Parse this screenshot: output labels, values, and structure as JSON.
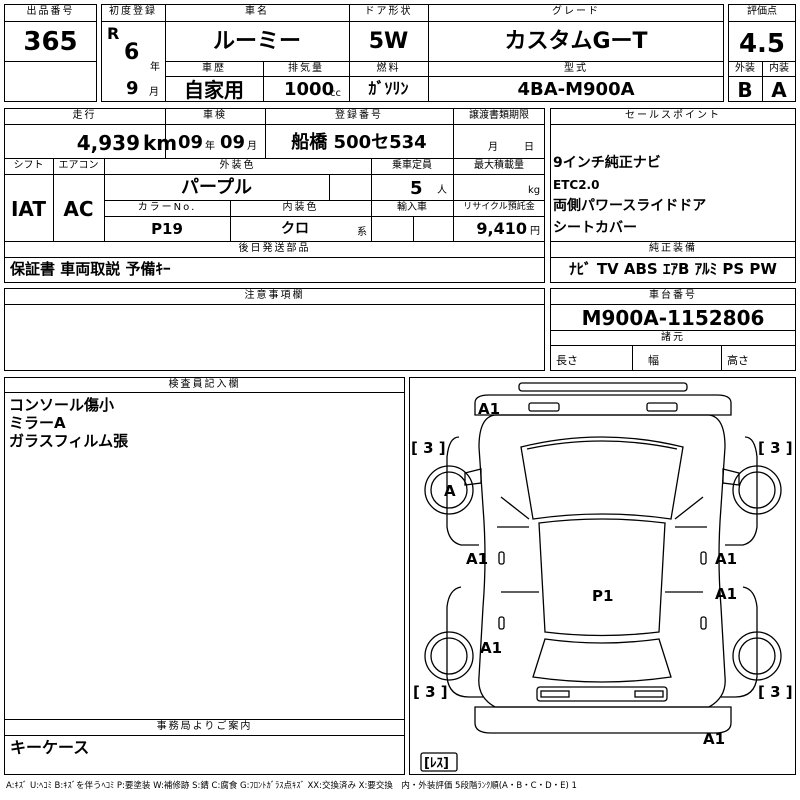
{
  "headers": {
    "lot": "出品番号",
    "first_reg": "初度登録",
    "car_name": "車名",
    "door": "ドア形状",
    "grade": "グレード",
    "score": "評価点",
    "history": "車歴",
    "displacement": "排気量",
    "fuel": "燃料",
    "model": "型式",
    "exterior": "外装",
    "interior": "内装",
    "mileage": "走行",
    "inspection": "車検",
    "plate": "登録番号",
    "transfer_docs": "譲渡書類期限",
    "sales_points": "セールスポイント",
    "shift": "シフト",
    "aircon": "エアコン",
    "ext_color": "外装色",
    "capacity": "乗車定員",
    "max_load": "最大積載量",
    "color_no": "カラーNo.",
    "int_color": "内装色",
    "import": "輸入車",
    "recycle": "リサイクル預託金",
    "later_parts": "後日発送部品",
    "genuine_equipment": "純正装備",
    "notes": "注意事項欄",
    "chassis": "車台番号",
    "specs": "諸元",
    "inspector": "検査員記入欄",
    "office": "事務局よりご案内"
  },
  "units": {
    "year": "年",
    "month": "月",
    "cc": "cc",
    "km": "km",
    "persons": "人",
    "kg": "kg",
    "kei": "系",
    "yen": "円",
    "length": "長さ",
    "width": "幅",
    "height": "高さ"
  },
  "vehicle": {
    "lot_number": "365",
    "era": "R",
    "reg_year": "6",
    "reg_month": "9",
    "car_name": "ルーミー",
    "door_type": "5W",
    "grade": "カスタムGーT",
    "score": "4.5",
    "history": "自家用",
    "displacement": "1000",
    "fuel": "ｶﾞｿﾘﾝ",
    "model_code": "4BA-M900A",
    "exterior_grade": "B",
    "interior_grade": "A",
    "mileage": "4,939",
    "inspection_year": "09",
    "inspection_month": "09",
    "plate": "船橋 500セ534",
    "shift": "IAT",
    "aircon": "AC",
    "ext_color": "パープル",
    "capacity": "5",
    "color_no": "P19",
    "int_color": "クロ",
    "recycle_fee": "9,410",
    "chassis_no": "M900A-1152806"
  },
  "sales_points": [
    "9インチ純正ナビ",
    "ETC2.0",
    "両側パワースライドドア",
    "シートカバー"
  ],
  "later_parts": "保証書 車両取説 予備ｷｰ",
  "genuine_equipment": "ﾅﾋﾞ TV ABS ｴｱB ｱﾙﾐ PS PW",
  "inspector_notes": [
    "コンソール傷小",
    "ミラーA",
    "ガラスフィルム張"
  ],
  "office_note": "キーケース",
  "diagram_marks": {
    "hood": "A1",
    "front_left_tire": "A",
    "left_front_door": "A1",
    "right_front_door": "A1",
    "right_rear_door": "A1",
    "roof": "P1",
    "left_rear_fender": "A1",
    "rear_bumper": "A1",
    "tire_fl": "[ 3 ]",
    "tire_fr": "[ 3 ]",
    "tire_rl": "[ 3 ]",
    "tire_rr": "[ 3 ]",
    "spare": "[ﾚｽ]"
  },
  "legend": "A:ｷｽﾞ U:ﾍｺﾐ B:ｷｽﾞを伴うﾍｺﾐ P:要塗装 W:補修跡 S:錆 C:腐食 G:ﾌﾛﾝﾄｶﾞﾗｽ点ｷｽﾞ XX:交換済み X:要交換　内・外装評価 5段階ﾗﾝｸ順(A・B・C・D・E) 1"
}
